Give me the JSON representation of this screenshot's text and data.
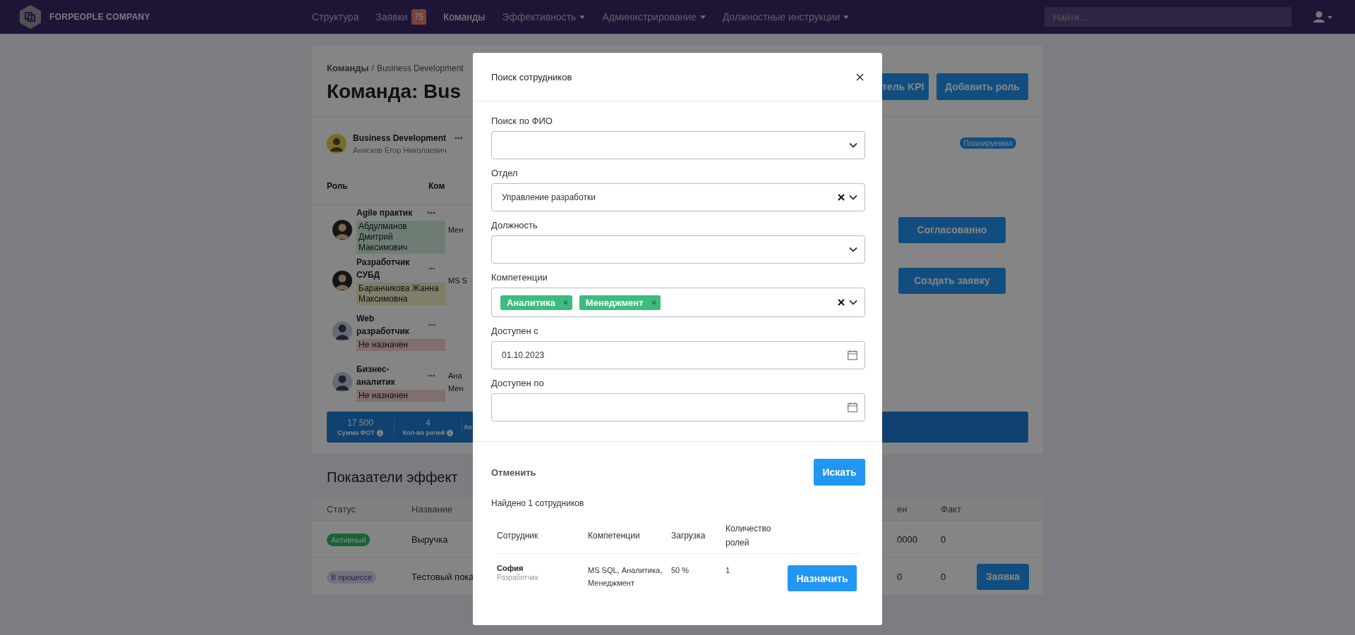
{
  "navbar": {
    "logo_text": "FORPEOPLE COMPANY",
    "menu": [
      {
        "label": "Структура",
        "selected": false,
        "dropdown": false
      },
      {
        "label": "Заявки",
        "badge": "75",
        "selected": false,
        "dropdown": false
      },
      {
        "label": "Команды",
        "selected": true,
        "dropdown": false
      },
      {
        "label": "Эффективность",
        "selected": false,
        "dropdown": true
      },
      {
        "label": "Администрирование",
        "selected": false,
        "dropdown": true
      },
      {
        "label": "Должностные инструкции",
        "selected": false,
        "dropdown": true
      }
    ],
    "search": {
      "placeholder": "Найти..."
    }
  },
  "team_page": {
    "breadcrumb": {
      "parent": "Команды",
      "separator": "/",
      "current": "Business Development"
    },
    "title": "Команда: Bus",
    "buttons": [
      "тель KPI",
      "Добавить роль"
    ],
    "team": {
      "name": "Business Development",
      "lead": "Анисков Егор Николаевич",
      "status": "Планируемая"
    },
    "columns": [
      "Роль",
      "Ком"
    ],
    "roles": [
      {
        "role": "Agile практик",
        "person": "Абдулманов Дмитрий Максимович",
        "kind": "assigned",
        "cells": [
          "Мен"
        ],
        "action": "Согласованно"
      },
      {
        "role": "Разработчик СУБД",
        "person": "Баранчикова Жанна Максимовна",
        "kind": "pending",
        "cells": [
          "MS S"
        ],
        "action": "Создать заявку"
      },
      {
        "role": "Web разработчик",
        "person": "Не назначен",
        "kind": "unassigned"
      },
      {
        "role": "Бизнес-аналитик",
        "person": "Не назначен",
        "kind": "unassigned",
        "cells": [
          "Ана",
          "Мен"
        ]
      }
    ],
    "stats": [
      {
        "value": "17 500",
        "label": "Сумма ФОТ"
      },
      {
        "value": "4",
        "label": "Кол-во ролей"
      },
      {
        "label": "Ко"
      }
    ]
  },
  "kpi": {
    "title": "Показатели эффект",
    "columns": [
      "Статус",
      "Название",
      "ен",
      "Факт"
    ],
    "rows": [
      {
        "status": "Активный",
        "kind": "active",
        "name": "Выручка",
        "column_3": "0000",
        "fact": "0"
      },
      {
        "status": "В процессе",
        "kind": "progress",
        "name": "Тестовый пока",
        "column_3": "0",
        "fact": "0",
        "action": "Заявка"
      }
    ]
  },
  "modal": {
    "title": "Поиск сотрудников",
    "fields": [
      {
        "label": "Поиск по ФИО",
        "kind": "select",
        "clearable": false
      },
      {
        "label": "Отдел",
        "kind": "select",
        "value": "Управление разработки",
        "clearable": true
      },
      {
        "label": "Должность",
        "kind": "select",
        "clearable": false
      },
      {
        "label": "Компетенции",
        "kind": "multiselect",
        "tags": [
          "Аналитика",
          "Менеджмент"
        ],
        "clearable": true
      },
      {
        "label": "Доступен с",
        "kind": "date",
        "value": "01.10.2023"
      },
      {
        "label": "Доступен по",
        "kind": "date"
      }
    ],
    "cancel": "Отменить",
    "submit": "Искать",
    "result_text": "Найдено 1 сотрудников",
    "columns": [
      "Сотрудник",
      "Компетенции",
      "Загрузка",
      "Количество ролей"
    ],
    "rows": [
      {
        "name": "София",
        "position": "Разработчик",
        "skills": "MS SQL, Аналитика, Менеджмент",
        "load": "50 %",
        "roles": "1",
        "action": "Назначить"
      }
    ]
  }
}
